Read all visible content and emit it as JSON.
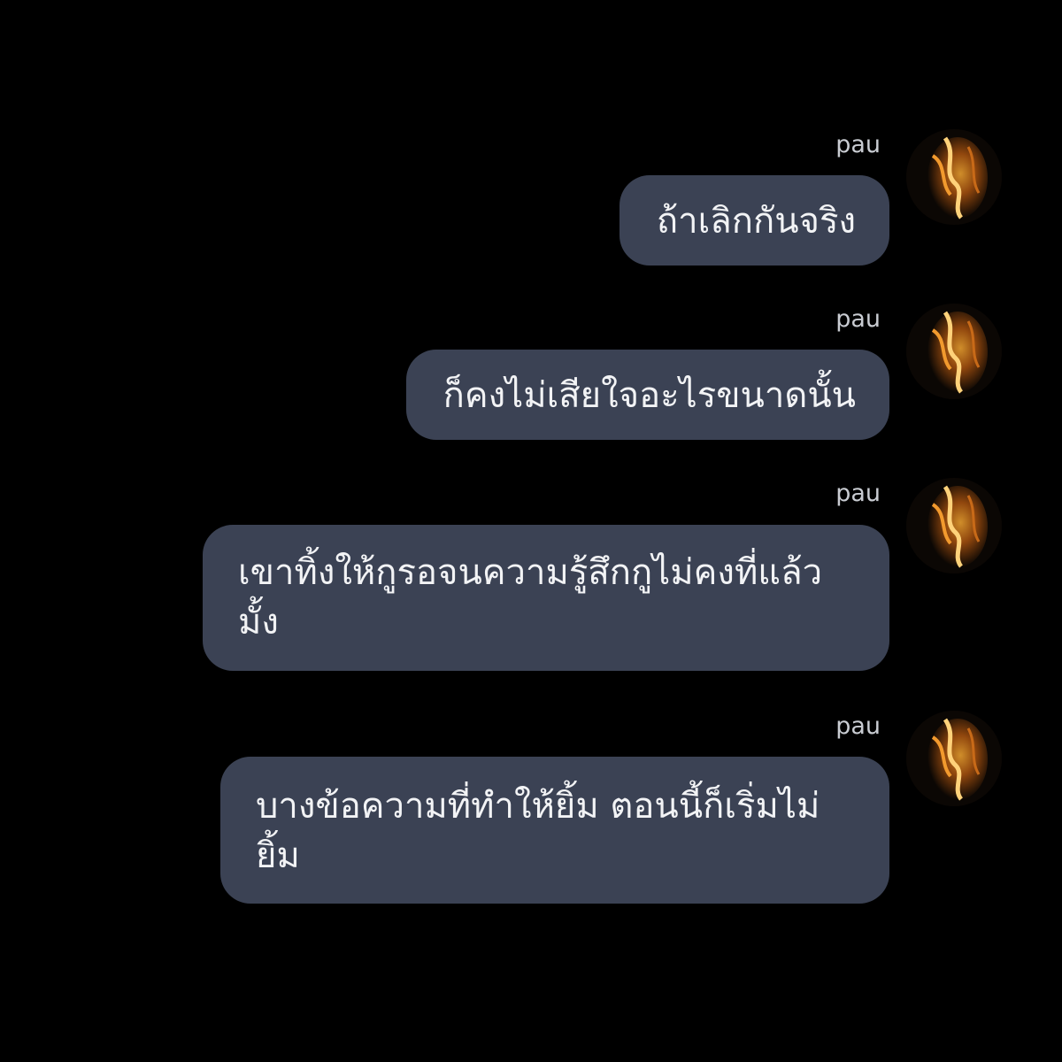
{
  "messages": [
    {
      "sender": "pau",
      "text": "ถ้าเลิกกันจริง",
      "avatar_icon": "user-avatar-icon"
    },
    {
      "sender": "pau",
      "text": "ก็คงไม่เสียใจอะไรขนาดนั้น",
      "avatar_icon": "user-avatar-icon"
    },
    {
      "sender": "pau",
      "text": "เขาทิ้งให้กูรอจนความรู้สึกกูไม่คงที่แล้วมั้ง",
      "avatar_icon": "user-avatar-icon"
    },
    {
      "sender": "pau",
      "text": "บางข้อความที่ทำให้ยิ้ม ตอนนี้ก็เริ่มไม่ยิ้ม",
      "avatar_icon": "user-avatar-icon"
    }
  ],
  "colors": {
    "background": "#000000",
    "bubble": "#3b4254",
    "bubble_text": "#f2f3f5",
    "sender_text": "#c9ccd2",
    "avatar_flame": "#e08a1e"
  }
}
